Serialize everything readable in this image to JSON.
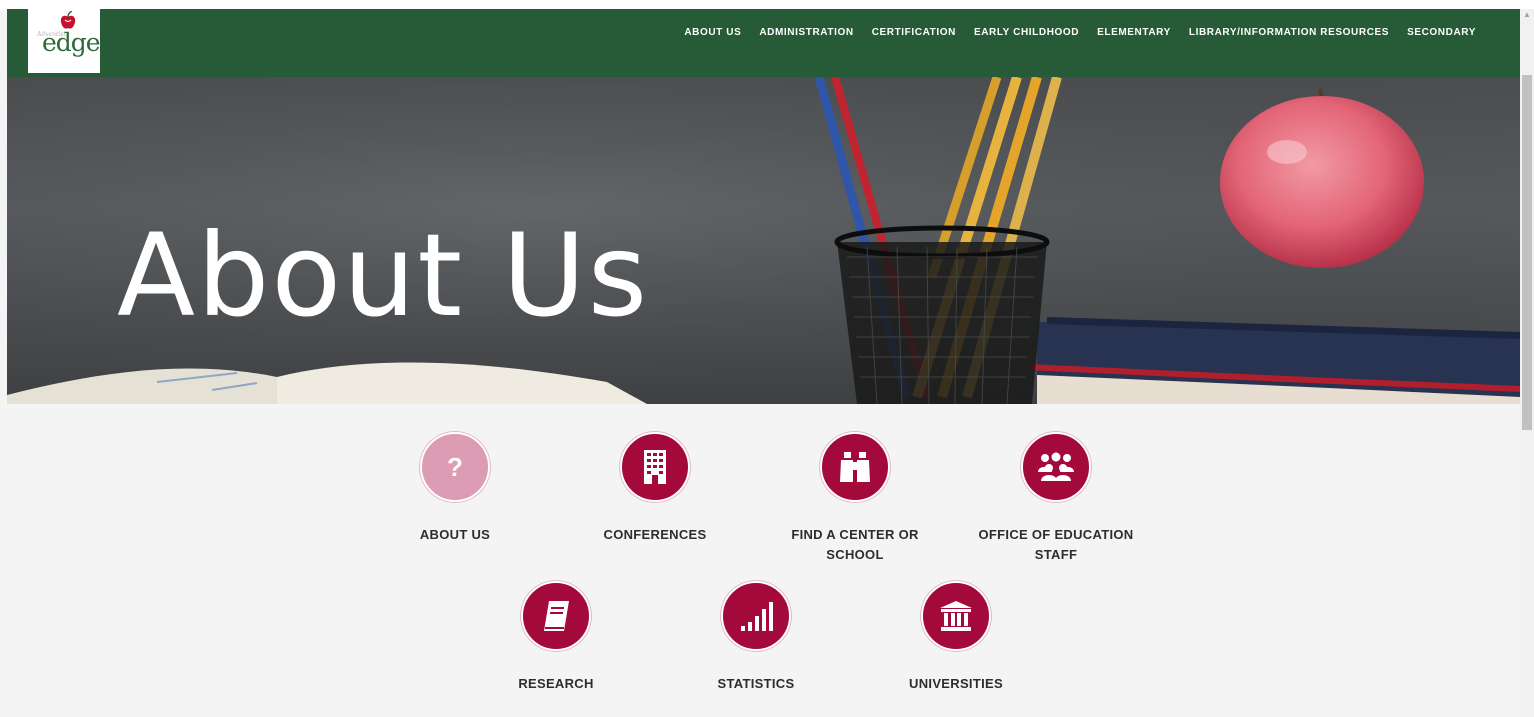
{
  "logo": {
    "tagline": "Adventist",
    "wordmark": "edge"
  },
  "nav": {
    "items": [
      {
        "label": "ABOUT US"
      },
      {
        "label": "ADMINISTRATION"
      },
      {
        "label": "CERTIFICATION"
      },
      {
        "label": "EARLY CHILDHOOD"
      },
      {
        "label": "ELEMENTARY"
      },
      {
        "label": "LIBRARY/INFORMATION RESOURCES"
      },
      {
        "label": "SECONDARY"
      }
    ]
  },
  "hero": {
    "title": "About Us"
  },
  "tiles": [
    {
      "label": "ABOUT US",
      "icon": "question-mark-icon",
      "active": true
    },
    {
      "label": "CONFERENCES",
      "icon": "building-icon",
      "active": false
    },
    {
      "label": "FIND A CENTER OR SCHOOL",
      "icon": "binoculars-icon",
      "active": false
    },
    {
      "label": "OFFICE OF EDUCATION STAFF",
      "icon": "people-icon",
      "active": false
    },
    {
      "label": "RESEARCH",
      "icon": "book-icon",
      "active": false
    },
    {
      "label": "STATISTICS",
      "icon": "bar-chart-icon",
      "active": false
    },
    {
      "label": "UNIVERSITIES",
      "icon": "institution-icon",
      "active": false
    }
  ],
  "colors": {
    "header": "#275a36",
    "tile": "#a3093b",
    "tile_active": "#dc9cb3"
  }
}
